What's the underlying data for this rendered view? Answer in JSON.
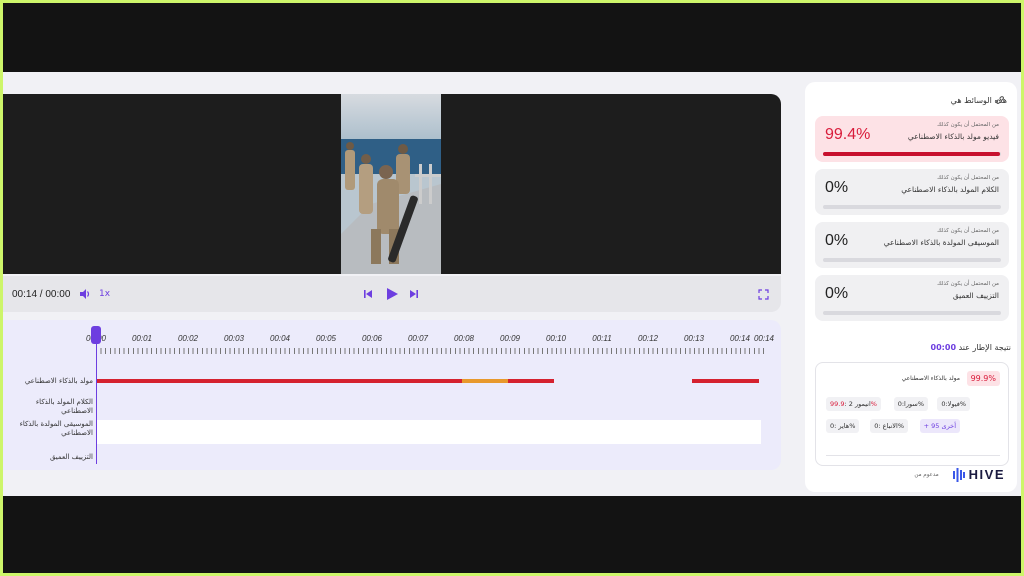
{
  "player": {
    "time_display": "00:14 / 00:00",
    "speed": "1x",
    "ruler_labels": [
      "00:00",
      "00:01",
      "00:02",
      "00:03",
      "00:04",
      "00:05",
      "00:06",
      "00:07",
      "00:08",
      "00:09",
      "00:10",
      "00:11",
      "00:12",
      "00:13",
      "00:14",
      "00:14"
    ]
  },
  "tracks": [
    {
      "label": "مولد بالذكاء الاصطناعي"
    },
    {
      "label": "الكلام المولد بالذكاء الاصطناعي"
    },
    {
      "label": "الموسيقى المولدة بالذكاء الاصطناعي"
    },
    {
      "label": "التزييف العميق"
    }
  ],
  "track_segments": [
    {
      "start": 0.0,
      "end": 7.93,
      "color": "#d5212f"
    },
    {
      "start": 7.93,
      "end": 8.93,
      "color": "#e8992c"
    },
    {
      "start": 8.93,
      "end": 9.93,
      "color": "#d5212f"
    },
    {
      "start": 12.93,
      "end": 14.4,
      "color": "#d5212f"
    }
  ],
  "panel": {
    "title": "هذه الوسائط هي",
    "cards": [
      {
        "pct": "99.4%",
        "sub": "من المحتمل أن يكون كذلك",
        "name": "فيديو مولد بالذكاء الاصطناعي",
        "fill": 0.994
      },
      {
        "pct": "0%",
        "sub": "من المحتمل أن يكون كذلك",
        "name": "الكلام المولد بالذكاء الاصطناعي",
        "fill": 0
      },
      {
        "pct": "0%",
        "sub": "من المحتمل أن يكون كذلك",
        "name": "الموسيقى المولدة بالذكاء الاصطناعي",
        "fill": 0
      },
      {
        "pct": "0%",
        "sub": "من المحتمل أن يكون كذلك",
        "name": "التزييف العميق",
        "fill": 0
      }
    ],
    "frame_result_label": "نتيجة الإطار عند",
    "frame_result_time": "00:00",
    "result": {
      "name": "مولد بالذكاء الاصطناعي",
      "badge": "99.9%",
      "chips_row1": [
        {
          "name": "فيولا:",
          "pct": "0%"
        },
        {
          "name": "سورا:",
          "pct": "0%"
        },
        {
          "name": "انيمور 2 :",
          "pct": "99.9%"
        }
      ],
      "chips_row2": [
        {
          "name": "+ 95 أخرى",
          "pct": ""
        },
        {
          "name": "الانباع :",
          "pct": "0%"
        },
        {
          "name": "هاير :",
          "pct": "0%"
        }
      ]
    },
    "powered_by": "مدعوم من",
    "brand": "HIVE"
  },
  "colors": {
    "accent": "#6d3ee0",
    "alert": "#d91c3b",
    "frame": "#cdf56a"
  }
}
